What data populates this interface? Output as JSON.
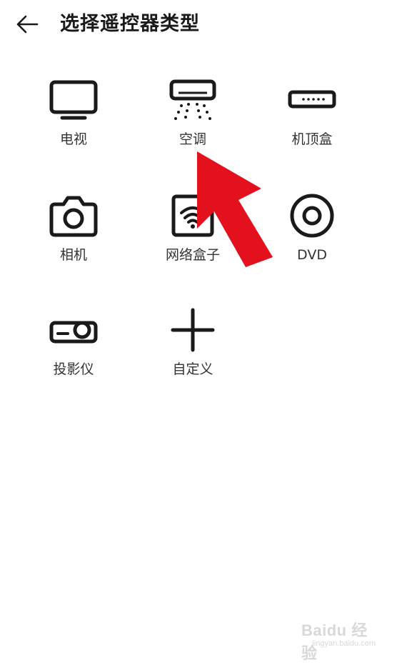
{
  "header": {
    "title": "选择遥控器类型"
  },
  "devices": [
    {
      "label": "电视",
      "icon": "tv-icon"
    },
    {
      "label": "空调",
      "icon": "air-conditioner-icon"
    },
    {
      "label": "机顶盒",
      "icon": "set-top-box-icon"
    },
    {
      "label": "相机",
      "icon": "camera-icon"
    },
    {
      "label": "网络盒子",
      "icon": "network-box-icon"
    },
    {
      "label": "DVD",
      "icon": "dvd-icon"
    },
    {
      "label": "投影仪",
      "icon": "projector-icon"
    },
    {
      "label": "自定义",
      "icon": "plus-icon"
    }
  ],
  "annotation": {
    "arrow_color": "#e3101e"
  },
  "watermark": {
    "brand": "Baidu 经验",
    "url": "jingyan.baidu.com"
  }
}
